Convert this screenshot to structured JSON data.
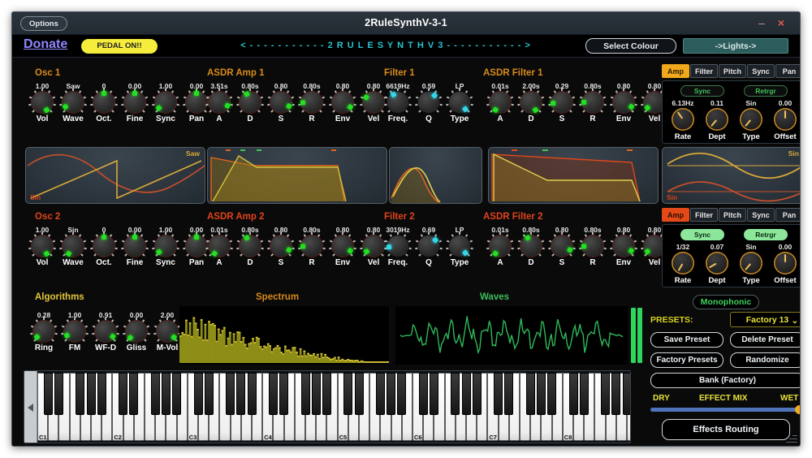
{
  "window": {
    "title": "2RuleSynthV-3-1",
    "options_label": "Options",
    "minimize": "–",
    "close": "×"
  },
  "banner": {
    "donate": "Donate",
    "pedal": "PEDAL ON!!",
    "scroller": "<  -  -  -  -  -  -  -  -  -  -  -  2 R U L E S Y N T H   V 3  -  -  -  -  -  -  -  -  -  -  -  >",
    "select_colour": "Select Colour",
    "lights": "->Lights->"
  },
  "sections": {
    "osc1": "Osc 1",
    "asdr_amp1": "ASDR Amp 1",
    "filter1": "Filter 1",
    "asdr_filter1": "ASDR Filter 1",
    "osc2": "Osc 2",
    "asdr_amp2": "ASDR Amp 2",
    "filter2": "Filter 2",
    "asdr_filter2": "ASDR Filter 2",
    "algorithms": "Algorithms",
    "spectrum": "Spectrum",
    "waves": "Waves"
  },
  "osc1_knobs": [
    {
      "value": "1.00",
      "label": "Vol",
      "angle": 150
    },
    {
      "value": "Saw",
      "label": "Wave",
      "angle": -120
    },
    {
      "value": "0",
      "label": "Oct.",
      "angle": 0
    },
    {
      "value": "0.00",
      "label": "Fine",
      "angle": 0
    },
    {
      "value": "1.00",
      "label": "Sync",
      "angle": -130
    },
    {
      "value": "0.00",
      "label": "Pan",
      "angle": 0
    }
  ],
  "asdr_amp1_knobs": [
    {
      "value": "3.51s",
      "label": "A",
      "angle": 112
    },
    {
      "value": "0.80s",
      "label": "D",
      "angle": -22
    },
    {
      "value": "0.80",
      "label": "S",
      "angle": 116
    },
    {
      "value": "0.80s",
      "label": "R",
      "angle": -92
    },
    {
      "value": "0.80",
      "label": "Env",
      "angle": 122
    },
    {
      "value": "0.80",
      "label": "Vel",
      "angle": -56
    }
  ],
  "filter1_knobs": [
    {
      "value": "6619Hz",
      "label": "Freq.",
      "angle": -30
    },
    {
      "value": "0.59",
      "label": "Q",
      "angle": 40
    },
    {
      "value": "LP",
      "label": "Type",
      "angle": 140
    }
  ],
  "asdr_filter1_knobs": [
    {
      "value": "0.01s",
      "label": "A",
      "angle": -148
    },
    {
      "value": "2.00s",
      "label": "D",
      "angle": 150
    },
    {
      "value": "0.29",
      "label": "S",
      "angle": -96
    },
    {
      "value": "0.80s",
      "label": "R",
      "angle": -90
    },
    {
      "value": "0.80",
      "label": "Env",
      "angle": 120
    },
    {
      "value": "0.80",
      "label": "Vel",
      "angle": -128
    }
  ],
  "osc2_knobs": [
    {
      "value": "1.00",
      "label": "Vol",
      "angle": 150
    },
    {
      "value": "Sin",
      "label": "Wave",
      "angle": -150
    },
    {
      "value": "0",
      "label": "Oct.",
      "angle": 0
    },
    {
      "value": "0.00",
      "label": "Fine",
      "angle": 0
    },
    {
      "value": "1.00",
      "label": "Sync",
      "angle": -132
    },
    {
      "value": "0.00",
      "label": "Pan",
      "angle": 0
    }
  ],
  "asdr_amp2_knobs": [
    {
      "value": "0.01s",
      "label": "A",
      "angle": -148
    },
    {
      "value": "0.80s",
      "label": "D",
      "angle": -22
    },
    {
      "value": "0.80",
      "label": "S",
      "angle": 116
    },
    {
      "value": "0.80s",
      "label": "R",
      "angle": -92
    },
    {
      "value": "0.80",
      "label": "Env",
      "angle": 122
    },
    {
      "value": "0.80",
      "label": "Vel",
      "angle": -128
    }
  ],
  "filter2_knobs": [
    {
      "value": "3019Hz",
      "label": "Freq.",
      "angle": -96
    },
    {
      "value": "0.69",
      "label": "Q",
      "angle": 48
    },
    {
      "value": "LP",
      "label": "Type",
      "angle": 140
    }
  ],
  "asdr_filter2_knobs": [
    {
      "value": "0.01s",
      "label": "A",
      "angle": -148
    },
    {
      "value": "0.80s",
      "label": "D",
      "angle": -22
    },
    {
      "value": "0.80",
      "label": "S",
      "angle": 116
    },
    {
      "value": "0.80s",
      "label": "R",
      "angle": -92
    },
    {
      "value": "0.80",
      "label": "Env",
      "angle": 122
    },
    {
      "value": "0.80",
      "label": "Vel",
      "angle": -128
    }
  ],
  "algorithm_knobs": [
    {
      "value": "0.28",
      "label": "Ring",
      "angle": -130
    },
    {
      "value": "1.00",
      "label": "FM",
      "angle": -118
    },
    {
      "value": "0.91",
      "label": "WF-D",
      "angle": 126
    },
    {
      "value": "0.00",
      "label": "Gliss",
      "angle": -136
    },
    {
      "value": "2.00",
      "label": "M-Vol",
      "angle": 132
    }
  ],
  "lfo1": {
    "tabs": [
      "Amp",
      "Filter",
      "Pitch",
      "Sync",
      "Pan"
    ],
    "active_tab": "Amp",
    "sync_label": "Sync",
    "sync_on": false,
    "retrig_label": "Retrgr",
    "retrig_on": false,
    "knobs": [
      {
        "value": "6.13Hz",
        "label": "Rate",
        "angle": -35
      },
      {
        "value": "0.11",
        "label": "Dept",
        "angle": -140
      },
      {
        "value": "Sin",
        "label": "Type",
        "angle": -140
      },
      {
        "value": "0.00",
        "label": "Offset",
        "angle": 0
      }
    ],
    "wave_top": "Sin",
    "wave_bottom": "Sin"
  },
  "lfo2": {
    "tabs": [
      "Amp",
      "Filter",
      "Pitch",
      "Sync",
      "Pan"
    ],
    "active_tab": "Amp",
    "sync_label": "Sync",
    "sync_on": true,
    "retrig_label": "Retrgr",
    "retrig_on": true,
    "knobs": [
      {
        "value": "1/32",
        "label": "Rate",
        "angle": -150
      },
      {
        "value": "0.07",
        "label": "Dept",
        "angle": -120
      },
      {
        "value": "Sin",
        "label": "Type",
        "angle": -140
      },
      {
        "value": "0.00",
        "label": "Offset",
        "angle": 0
      }
    ]
  },
  "displays": {
    "osc1_wave_label": "Saw",
    "osc1_sin_label": "Sin",
    "osc2_wave_label": "Sin",
    "osc2_sin_label": "Sin"
  },
  "keyboard": {
    "octave_labels": [
      "C1",
      "C2",
      "C3",
      "C4",
      "C5",
      "C6",
      "C7",
      "C8"
    ],
    "scroll_arrow": "left-arrow"
  },
  "presets": {
    "monophonic": "Monophonic",
    "presets_label": "PRESETS:",
    "selected_preset": "Factory 13",
    "chevron": "⌄",
    "save_preset": "Save Preset",
    "delete_preset": "Delete Preset",
    "factory_presets": "Factory Presets",
    "randomize": "Randomize",
    "bank": "Bank (Factory)",
    "dry": "DRY",
    "effect_mix": "EFFECT MIX",
    "wet": "WET",
    "effects_routing": "Effects Routing",
    "mix_position_pct": 97
  },
  "colors": {
    "accent_amber": "#f0a81c",
    "accent_red": "#e34a18",
    "accent_green": "#2fd45a",
    "accent_yellow": "#e8e23c",
    "accent_cyan": "#29c3cf"
  }
}
